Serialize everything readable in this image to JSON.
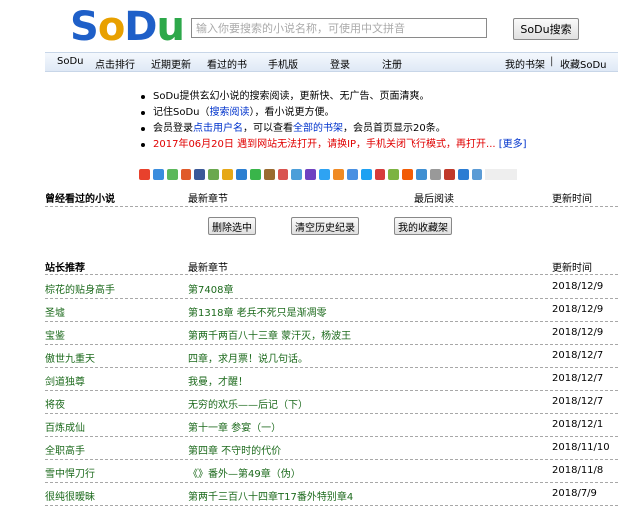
{
  "header": {
    "logo_text": [
      "S",
      "o",
      "D",
      "u"
    ],
    "search_placeholder": "输入你要搜索的小说名称，可使用中文拼音",
    "search_button": "SoDu搜索"
  },
  "nav": {
    "left": [
      "SoDu",
      "点击排行",
      "近期更新",
      "看过的书",
      "手机版",
      "登录",
      "注册"
    ],
    "right": [
      "我的书架",
      "收藏SoDu"
    ],
    "separator": "|"
  },
  "info": {
    "line1": "SoDu提供玄幻小说的搜索阅读，更新快、无广告、页面清爽。",
    "line2_pre": "记住SoDu（",
    "line2_link": "搜索阅读",
    "line2_post": "），看小说更方便。",
    "line3_pre": "会员登录",
    "line3_link1": "点击用户名",
    "line3_mid": "，可以查看",
    "line3_link2": "全部的书架",
    "line3_post": "，会员首页显示20条。",
    "line4_red": "2017年06月20日  遇到网站无法打开，请换IP，手机关闭飞行模式，再打开... ",
    "line4_more": "[更多]"
  },
  "share_icon_colors": [
    "#e8412c",
    "#3a8dde",
    "#5cb85c",
    "#e05a2a",
    "#3b5998",
    "#6aa84f",
    "#e6a817",
    "#2c7fd1",
    "#39b54a",
    "#9a6b2f",
    "#d9534f",
    "#4c9ed9",
    "#6f42c1",
    "#2ea3f2",
    "#f08a24",
    "#4a90e2",
    "#1da1f2",
    "#d63c3c",
    "#7cb342",
    "#f25c05",
    "#3f8fd2",
    "#999999",
    "#c0392b",
    "#2b7cd3",
    "#5b9bd5"
  ],
  "history": {
    "title": "曾经看过的小说",
    "col_chapter": "最新章节",
    "col_last_read": "最后阅读",
    "col_time": "更新时间",
    "buttons": [
      "删除选中",
      "清空历史纪录",
      "我的收藏架"
    ]
  },
  "recommend": {
    "title": "站长推荐",
    "col_chapter": "最新章节",
    "col_time": "更新时间",
    "rows": [
      {
        "name": "棕花的贴身高手",
        "chapter": "第7408章",
        "date": "2018/12/9"
      },
      {
        "name": "圣墟",
        "chapter": "第1318章 老兵不死只是渐凋零",
        "date": "2018/12/9"
      },
      {
        "name": "宝鉴",
        "chapter": "第两千两百八十三章 蒙汗灭，杨波王",
        "date": "2018/12/9"
      },
      {
        "name": "傲世九重天",
        "chapter": "四章，求月票！说几句话。",
        "date": "2018/12/7"
      },
      {
        "name": "剑道独尊",
        "chapter": "我曼，才醒！",
        "date": "2018/12/7"
      },
      {
        "name": "将夜",
        "chapter": "无穷的欢乐——后记（下）",
        "date": "2018/12/7"
      },
      {
        "name": "百炼成仙",
        "chapter": "第十一章 参宴（一）",
        "date": "2018/12/1"
      },
      {
        "name": "全职高手",
        "chapter": "第四章 不守时的代价",
        "date": "2018/11/10"
      },
      {
        "name": "雪中悍刀行",
        "chapter": "《》番外—第49章（伪）",
        "date": "2018/11/8"
      },
      {
        "name": "很纯很暧昧",
        "chapter": "第两千三百八十四章T17番外特别章4",
        "date": "2018/7/9"
      }
    ]
  }
}
